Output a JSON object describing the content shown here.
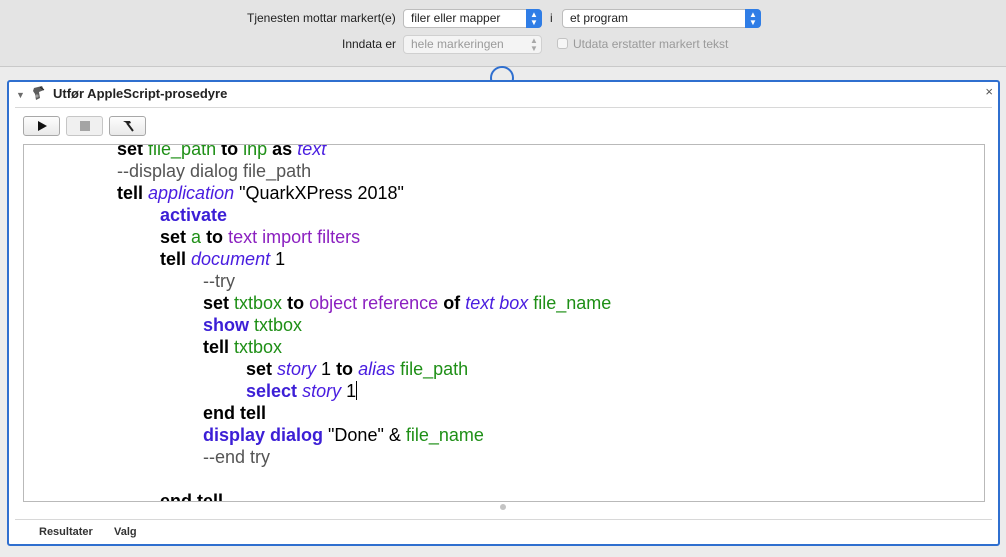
{
  "header": {
    "receives_label": "Tjenesten mottar markert(e)",
    "receives_value": "filer eller mapper",
    "in_label": "i",
    "in_value": "et program",
    "input_label": "Inndata er",
    "input_value": "hele markeringen",
    "replace_label": "Utdata erstatter markert tekst",
    "accent_color": "#2f7de6"
  },
  "action": {
    "title": "Utfør AppleScript-prosedyre",
    "close": "×",
    "toolbar": [
      "play-icon",
      "stop-icon",
      "hammer-icon"
    ]
  },
  "code": {
    "lines": [
      {
        "indent": 2,
        "tokens": [
          [
            "kw",
            "set"
          ],
          [
            "t",
            " "
          ],
          [
            "var",
            "file_path"
          ],
          [
            "t",
            " "
          ],
          [
            "kw",
            "to"
          ],
          [
            "t",
            " "
          ],
          [
            "var",
            "inp"
          ],
          [
            "t",
            " "
          ],
          [
            "kw",
            "as"
          ],
          [
            "t",
            " "
          ],
          [
            "cls",
            "text"
          ]
        ]
      },
      {
        "indent": 2,
        "tokens": [
          [
            "cmt",
            "--display dialog file_path"
          ]
        ]
      },
      {
        "indent": 2,
        "tokens": [
          [
            "kw",
            "tell"
          ],
          [
            "t",
            " "
          ],
          [
            "cls",
            "application"
          ],
          [
            "t",
            " \"QuarkXPress 2018\""
          ]
        ]
      },
      {
        "indent": 3,
        "tokens": [
          [
            "ak",
            "activate"
          ]
        ]
      },
      {
        "indent": 3,
        "tokens": [
          [
            "kw",
            "set"
          ],
          [
            "t",
            " "
          ],
          [
            "var",
            "a"
          ],
          [
            "t",
            " "
          ],
          [
            "kw",
            "to"
          ],
          [
            "t",
            " "
          ],
          [
            "prop",
            "text import filters"
          ]
        ]
      },
      {
        "indent": 3,
        "tokens": [
          [
            "kw",
            "tell"
          ],
          [
            "t",
            " "
          ],
          [
            "cls",
            "document"
          ],
          [
            "t",
            " 1"
          ]
        ]
      },
      {
        "indent": 4,
        "tokens": [
          [
            "cmt",
            "--try"
          ]
        ]
      },
      {
        "indent": 4,
        "tokens": [
          [
            "kw",
            "set"
          ],
          [
            "t",
            " "
          ],
          [
            "var",
            "txtbox"
          ],
          [
            "t",
            " "
          ],
          [
            "kw",
            "to"
          ],
          [
            "t",
            " "
          ],
          [
            "prop",
            "object reference"
          ],
          [
            "t",
            " "
          ],
          [
            "kw",
            "of"
          ],
          [
            "t",
            " "
          ],
          [
            "cls",
            "text box"
          ],
          [
            "t",
            " "
          ],
          [
            "var",
            "file_name"
          ]
        ]
      },
      {
        "indent": 4,
        "tokens": [
          [
            "ak",
            "show"
          ],
          [
            "t",
            " "
          ],
          [
            "var",
            "txtbox"
          ]
        ]
      },
      {
        "indent": 4,
        "tokens": [
          [
            "kw",
            "tell"
          ],
          [
            "t",
            " "
          ],
          [
            "var",
            "txtbox"
          ]
        ]
      },
      {
        "indent": 5,
        "tokens": [
          [
            "kw",
            "set"
          ],
          [
            "t",
            " "
          ],
          [
            "cls",
            "story"
          ],
          [
            "t",
            " 1 "
          ],
          [
            "kw",
            "to"
          ],
          [
            "t",
            " "
          ],
          [
            "cls",
            "alias"
          ],
          [
            "t",
            " "
          ],
          [
            "var",
            "file_path"
          ]
        ]
      },
      {
        "indent": 5,
        "tokens": [
          [
            "ak",
            "select"
          ],
          [
            "t",
            " "
          ],
          [
            "cls",
            "story"
          ],
          [
            "t",
            " 1"
          ],
          [
            "caret",
            ""
          ]
        ]
      },
      {
        "indent": 4,
        "tokens": [
          [
            "kw",
            "end tell"
          ]
        ]
      },
      {
        "indent": 4,
        "tokens": [
          [
            "ak",
            "display dialog"
          ],
          [
            "t",
            " \"Done\" & "
          ],
          [
            "var",
            "file_name"
          ]
        ]
      },
      {
        "indent": 4,
        "tokens": [
          [
            "cmt",
            "--end try"
          ]
        ]
      },
      {
        "indent": 0,
        "tokens": [
          [
            "t",
            ""
          ]
        ]
      },
      {
        "indent": 3,
        "tokens": [
          [
            "kw",
            "end tell"
          ]
        ]
      }
    ]
  },
  "footer": {
    "results_tab": "Resultater",
    "options_tab": "Valg"
  }
}
